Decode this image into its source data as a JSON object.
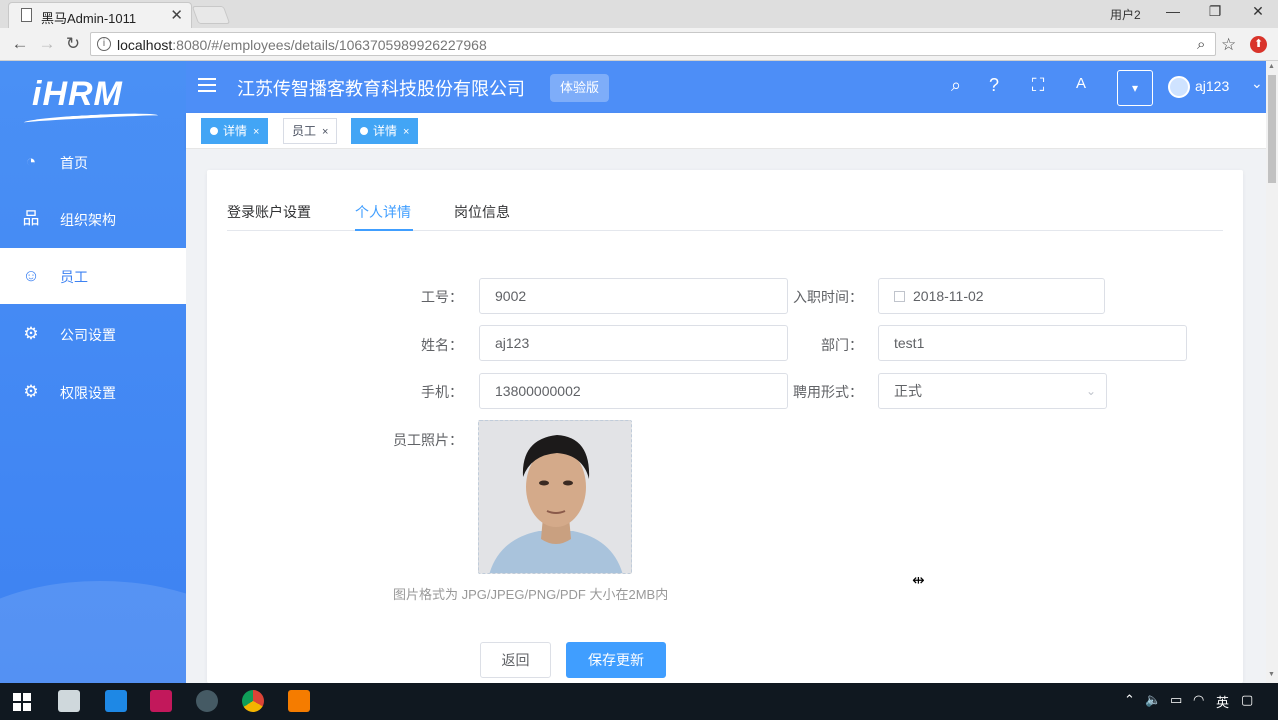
{
  "browser": {
    "tab_title": "黑马Admin-1011",
    "user_label": "用户2",
    "url_host": "localhost",
    "url_rest": ":8080/#/employees/details/1063705989926227968"
  },
  "sidebar": {
    "logo": "iHRM",
    "items": [
      {
        "label": "首页",
        "icon": "dashboard-icon"
      },
      {
        "label": "组织架构",
        "icon": "org-tree-icon"
      },
      {
        "label": "员工",
        "icon": "employee-icon"
      },
      {
        "label": "公司设置",
        "icon": "gear-icon"
      },
      {
        "label": "权限设置",
        "icon": "gear-icon"
      }
    ],
    "active_index": 2
  },
  "header": {
    "company": "江苏传智播客教育科技股份有限公司",
    "badge": "体验版",
    "username": "aj123"
  },
  "tags": [
    {
      "label": "详情",
      "active": true
    },
    {
      "label": "员工",
      "active": false
    },
    {
      "label": "详情",
      "active": true
    }
  ],
  "tabs": [
    {
      "label": "登录账户设置",
      "active": false
    },
    {
      "label": "个人详情",
      "active": true
    },
    {
      "label": "岗位信息",
      "active": false
    }
  ],
  "form": {
    "employee_no_label": "工号：",
    "employee_no": "9002",
    "hire_date_label": "入职时间：",
    "hire_date": "2018-11-02",
    "name_label": "姓名：",
    "name": "aj123",
    "dept_label": "部门：",
    "dept": "test1",
    "mobile_label": "手机：",
    "mobile": "13800000002",
    "employment_type_label": "聘用形式：",
    "employment_type": "正式",
    "photo_label": "员工照片：",
    "photo_hint": "图片格式为 JPG/JPEG/PNG/PDF 大小在2MB内",
    "back_button": "返回",
    "save_button": "保存更新"
  },
  "taskbar": {
    "ime": "英"
  },
  "colors": {
    "sidebar": "#4a90f5",
    "header": "#4d8ef7",
    "primary": "#409eff"
  }
}
